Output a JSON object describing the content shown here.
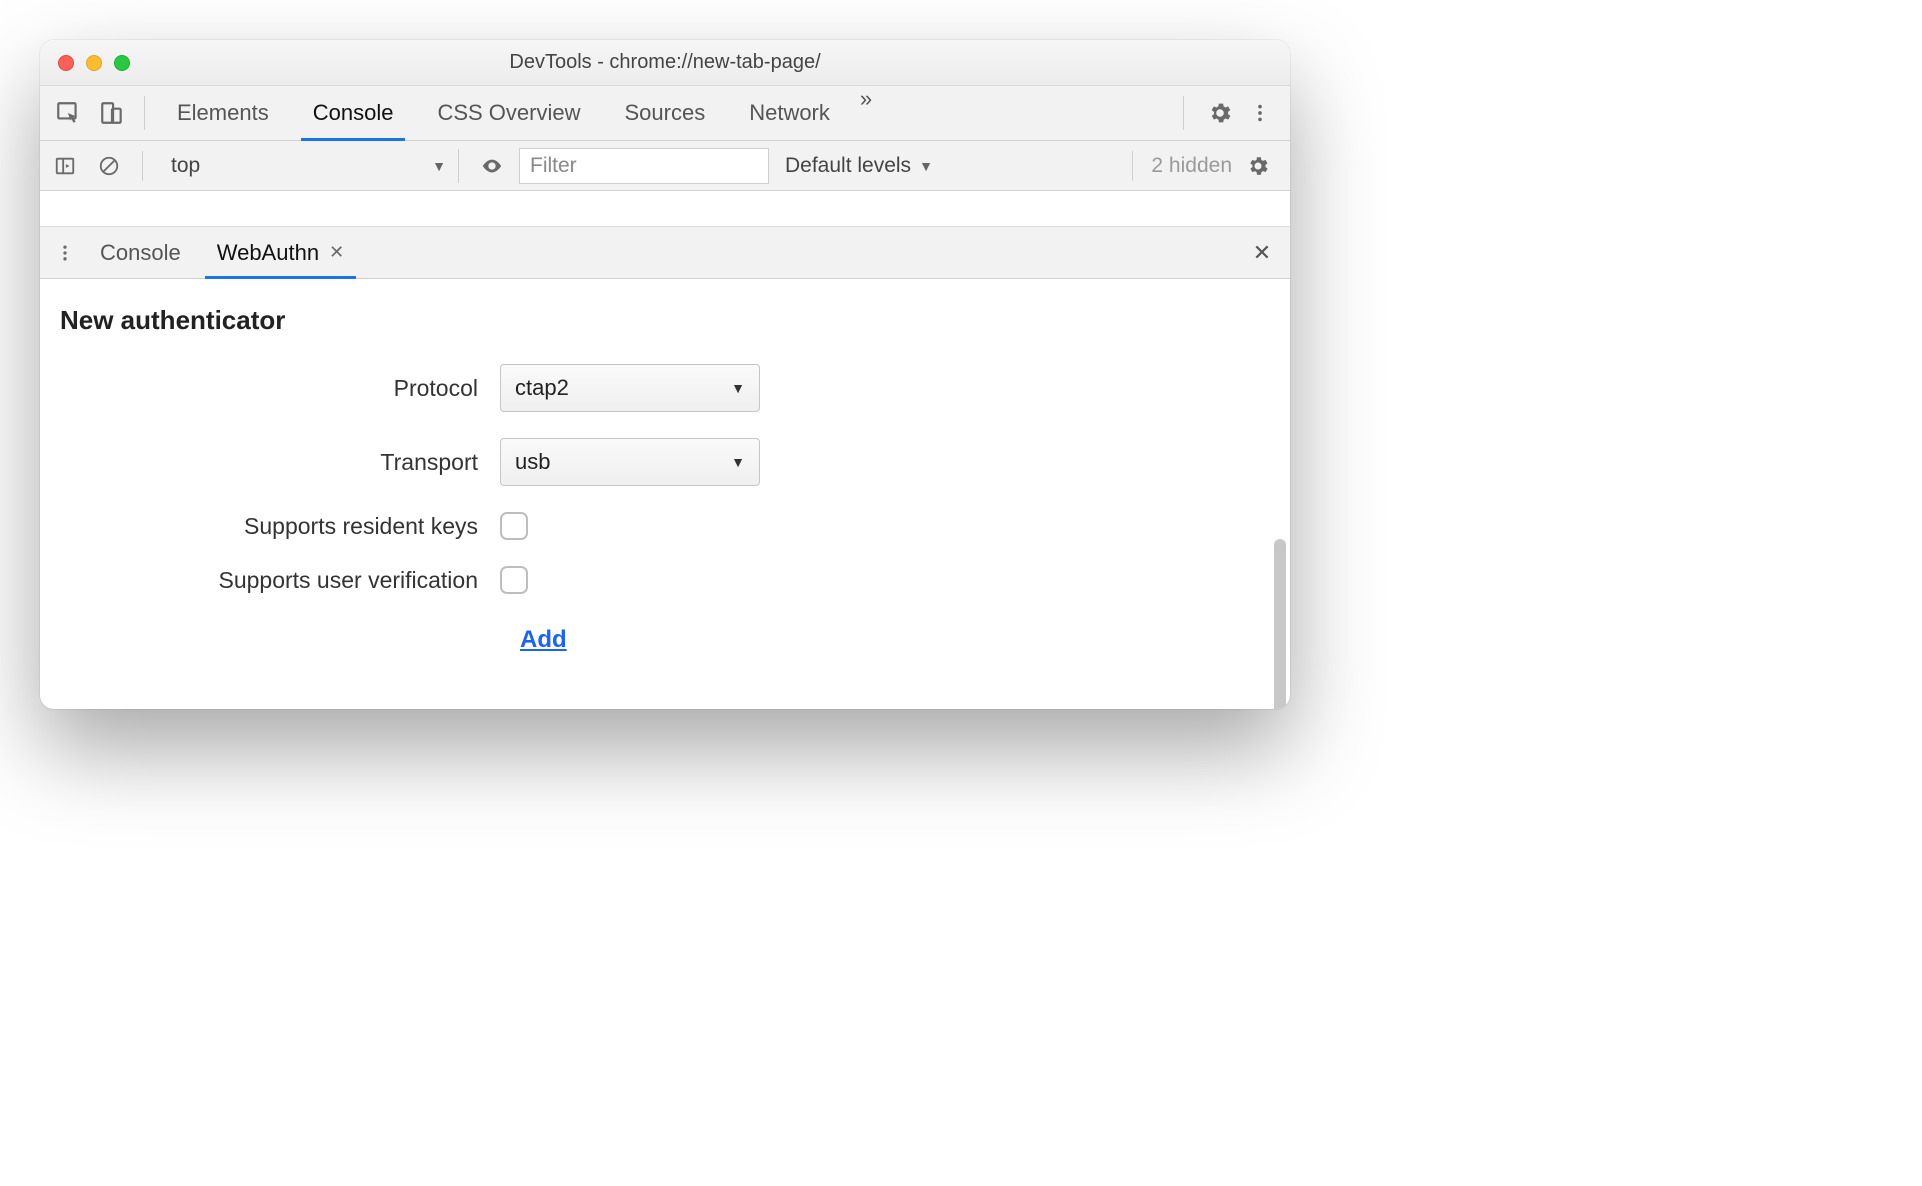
{
  "window": {
    "title": "DevTools - chrome://new-tab-page/"
  },
  "main_tabs": {
    "elements": "Elements",
    "console": "Console",
    "css_overview": "CSS Overview",
    "sources": "Sources",
    "network": "Network",
    "more": "»"
  },
  "console_toolbar": {
    "context": "top",
    "filter_placeholder": "Filter",
    "levels": "Default levels",
    "hidden": "2 hidden"
  },
  "drawer": {
    "tab_console": "Console",
    "tab_webauthn": "WebAuthn"
  },
  "webauthn": {
    "heading": "New authenticator",
    "labels": {
      "protocol": "Protocol",
      "transport": "Transport",
      "resident": "Supports resident keys",
      "uv": "Supports user verification"
    },
    "values": {
      "protocol": "ctap2",
      "transport": "usb"
    },
    "add": "Add"
  }
}
